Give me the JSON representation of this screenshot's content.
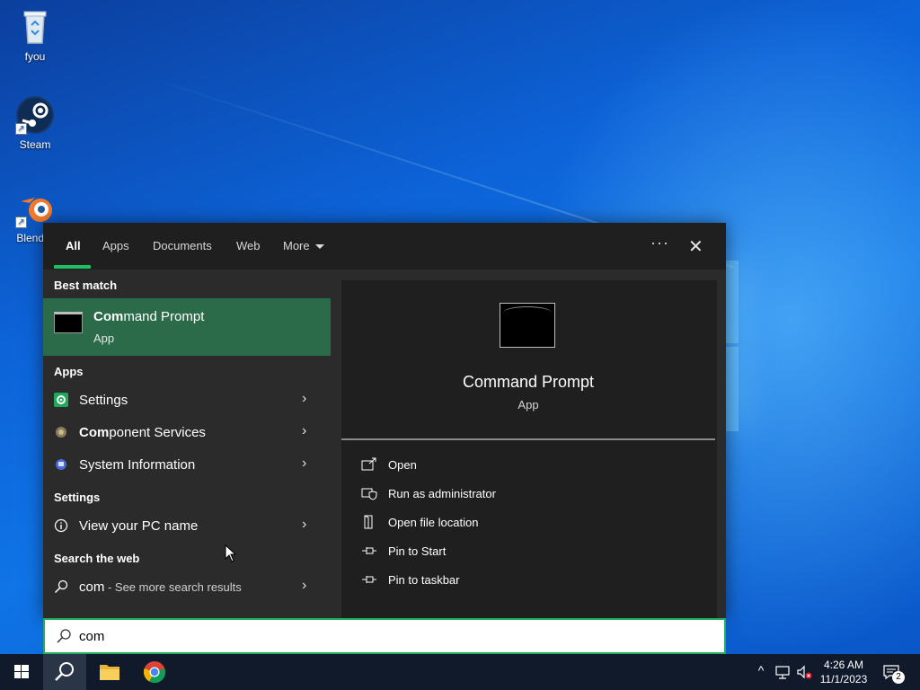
{
  "desktop": {
    "icons": [
      {
        "label": "fyou",
        "icon": "recycle-bin-icon"
      },
      {
        "label": "Steam",
        "icon": "steam-icon"
      },
      {
        "label": "Blender",
        "icon": "blender-icon"
      }
    ]
  },
  "search_panel": {
    "tabs": [
      {
        "label": "All",
        "active": true
      },
      {
        "label": "Apps"
      },
      {
        "label": "Documents"
      },
      {
        "label": "Web"
      },
      {
        "label": "More"
      }
    ],
    "more_options_icon": "ellipsis-icon",
    "close_icon": "close-icon",
    "best_match_label": "Best match",
    "best_match": {
      "title_bold": "Com",
      "title_rest": "mand Prompt",
      "subtitle": "App"
    },
    "apps_label": "Apps",
    "apps": [
      {
        "bold": "",
        "rest": "Settings",
        "icon": "settings-gear-icon"
      },
      {
        "bold": "Com",
        "rest": "ponent Services",
        "icon": "component-services-icon"
      },
      {
        "bold": "",
        "rest": "System Information",
        "icon": "system-information-icon"
      }
    ],
    "settings_label": "Settings",
    "settings": [
      {
        "label": "View your PC name",
        "icon": "info-icon"
      }
    ],
    "web_label": "Search the web",
    "web": {
      "query": "com",
      "suffix": " - See more search results"
    },
    "preview": {
      "title": "Command Prompt",
      "subtitle": "App",
      "actions": [
        {
          "label": "Open",
          "icon": "open-icon"
        },
        {
          "label": "Run as administrator",
          "icon": "shield-icon"
        },
        {
          "label": "Open file location",
          "icon": "file-location-icon"
        },
        {
          "label": "Pin to Start",
          "icon": "pin-icon"
        },
        {
          "label": "Pin to taskbar",
          "icon": "pin-icon"
        }
      ]
    }
  },
  "search_box": {
    "value": "com"
  },
  "taskbar": {
    "time": "4:26 AM",
    "date": "11/1/2023",
    "notification_count": "2"
  },
  "colors": {
    "accent": "#1fbf63",
    "best_match_bg": "#2b6b4a",
    "taskbar_bg": "#101a2b"
  }
}
